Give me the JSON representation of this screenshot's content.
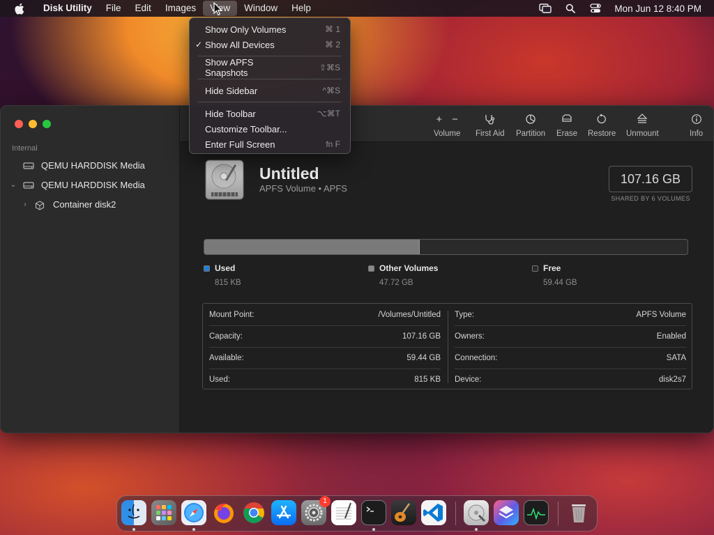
{
  "menubar": {
    "app_name": "Disk Utility",
    "items": [
      "File",
      "Edit",
      "Images",
      "View",
      "Window",
      "Help"
    ],
    "active_item": "View",
    "clock": "Mon Jun 12  8:40 PM"
  },
  "view_menu": {
    "items": [
      {
        "label": "Show Only Volumes",
        "shortcut": "⌘ 1",
        "checked": false
      },
      {
        "label": "Show All Devices",
        "shortcut": "⌘ 2",
        "checked": true
      },
      {
        "label": "Show APFS Snapshots",
        "shortcut": "⇧⌘S",
        "checked": false
      },
      {
        "label": "Hide Sidebar",
        "shortcut": "^⌘S",
        "checked": false
      },
      {
        "label": "Hide Toolbar",
        "shortcut": "⌥⌘T",
        "checked": false
      },
      {
        "label": "Customize Toolbar...",
        "shortcut": "",
        "checked": false
      },
      {
        "label": "Enter Full Screen",
        "shortcut": "fn F",
        "checked": false
      }
    ],
    "check_mark": "✓"
  },
  "sidebar": {
    "section": "Internal",
    "items": [
      {
        "label": "QEMU HARDDISK Media",
        "expanded": null
      },
      {
        "label": "QEMU HARDDISK Media",
        "expanded": true
      },
      {
        "label": "Container disk2",
        "expanded": false
      }
    ]
  },
  "toolbar": {
    "volume": "Volume",
    "first_aid": "First Aid",
    "partition": "Partition",
    "erase": "Erase",
    "restore": "Restore",
    "unmount": "Unmount",
    "info": "Info",
    "plus": "+",
    "minus": "−"
  },
  "volume": {
    "name": "Untitled",
    "subtitle": "APFS Volume • APFS",
    "capacity": "107.16 GB",
    "capacity_note": "SHARED BY 6 VOLUMES",
    "used_fraction": 0.4465
  },
  "legend": [
    {
      "label": "Used",
      "value": "815 KB",
      "color": "#1e7fd6"
    },
    {
      "label": "Other Volumes",
      "value": "47.72 GB",
      "color": "#8a8a8a"
    },
    {
      "label": "Free",
      "value": "59.44 GB",
      "color": "#2a2a2a"
    }
  ],
  "info_left": [
    {
      "key": "Mount Point:",
      "value": "/Volumes/Untitled"
    },
    {
      "key": "Capacity:",
      "value": "107.16 GB"
    },
    {
      "key": "Available:",
      "value": "59.44 GB"
    },
    {
      "key": "Used:",
      "value": "815 KB"
    }
  ],
  "info_right": [
    {
      "key": "Type:",
      "value": "APFS Volume"
    },
    {
      "key": "Owners:",
      "value": "Enabled"
    },
    {
      "key": "Connection:",
      "value": "SATA"
    },
    {
      "key": "Device:",
      "value": "disk2s7"
    }
  ],
  "dock": {
    "apps": [
      "finder",
      "launchpad",
      "safari",
      "firefox",
      "chrome",
      "app-store",
      "system-settings",
      "textedit",
      "terminal",
      "garageband",
      "vscode",
      "disk-utility",
      "shortcuts",
      "activity-monitor",
      "trash"
    ],
    "badge": "1"
  }
}
